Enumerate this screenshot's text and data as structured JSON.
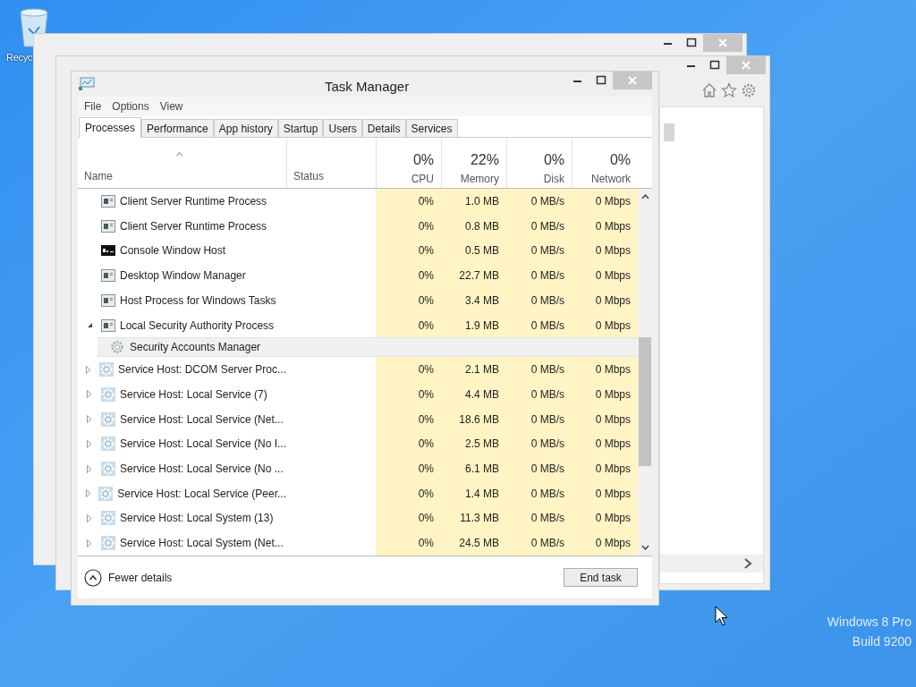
{
  "desktop": {
    "icon_label": "Recyc",
    "watermark": [
      "Windows 8 Pro",
      "Build 9200"
    ]
  },
  "window": {
    "title": "Task Manager"
  },
  "menu": [
    "File",
    "Options",
    "View"
  ],
  "tabs": [
    {
      "label": "Processes",
      "selected": true
    },
    {
      "label": "Performance",
      "selected": false
    },
    {
      "label": "App history",
      "selected": false
    },
    {
      "label": "Startup",
      "selected": false
    },
    {
      "label": "Users",
      "selected": false
    },
    {
      "label": "Details",
      "selected": false
    },
    {
      "label": "Services",
      "selected": false
    }
  ],
  "columns": [
    {
      "label": "Name"
    },
    {
      "label": "Status"
    },
    {
      "label": "CPU",
      "total": "0%"
    },
    {
      "label": "Memory",
      "total": "22%"
    },
    {
      "label": "Disk",
      "total": "0%"
    },
    {
      "label": "Network",
      "total": "0%"
    }
  ],
  "rows": [
    {
      "kind": "app",
      "name": "Client Server Runtime Process",
      "cpu": "0%",
      "memory": "1.0 MB",
      "disk": "0 MB/s",
      "network": "0 Mbps"
    },
    {
      "kind": "app",
      "name": "Client Server Runtime Process",
      "cpu": "0%",
      "memory": "0.8 MB",
      "disk": "0 MB/s",
      "network": "0 Mbps"
    },
    {
      "kind": "console",
      "name": "Console Window Host",
      "cpu": "0%",
      "memory": "0.5 MB",
      "disk": "0 MB/s",
      "network": "0 Mbps"
    },
    {
      "kind": "app",
      "name": "Desktop Window Manager",
      "cpu": "0%",
      "memory": "22.7 MB",
      "disk": "0 MB/s",
      "network": "0 Mbps"
    },
    {
      "kind": "app",
      "name": "Host Process for Windows Tasks",
      "cpu": "0%",
      "memory": "3.4 MB",
      "disk": "0 MB/s",
      "network": "0 Mbps"
    },
    {
      "kind": "app",
      "name": "Local Security Authority Process",
      "expanded": true,
      "cpu": "0%",
      "memory": "1.9 MB",
      "disk": "0 MB/s",
      "network": "0 Mbps"
    },
    {
      "kind": "child",
      "name": "Security Accounts Manager"
    },
    {
      "kind": "service",
      "name": "Service Host: DCOM Server Proc...",
      "expanded": false,
      "cpu": "0%",
      "memory": "2.1 MB",
      "disk": "0 MB/s",
      "network": "0 Mbps"
    },
    {
      "kind": "service",
      "name": "Service Host: Local Service (7)",
      "expanded": false,
      "cpu": "0%",
      "memory": "4.4 MB",
      "disk": "0 MB/s",
      "network": "0 Mbps"
    },
    {
      "kind": "service",
      "name": "Service Host: Local Service (Net...",
      "expanded": false,
      "cpu": "0%",
      "memory": "18.6 MB",
      "disk": "0 MB/s",
      "network": "0 Mbps"
    },
    {
      "kind": "service",
      "name": "Service Host: Local Service (No I...",
      "expanded": false,
      "cpu": "0%",
      "memory": "2.5 MB",
      "disk": "0 MB/s",
      "network": "0 Mbps"
    },
    {
      "kind": "service",
      "name": "Service Host: Local Service (No ...",
      "expanded": false,
      "cpu": "0%",
      "memory": "6.1 MB",
      "disk": "0 MB/s",
      "network": "0 Mbps"
    },
    {
      "kind": "service",
      "name": "Service Host: Local Service (Peer...",
      "expanded": false,
      "cpu": "0%",
      "memory": "1.4 MB",
      "disk": "0 MB/s",
      "network": "0 Mbps"
    },
    {
      "kind": "service",
      "name": "Service Host: Local System (13)",
      "expanded": false,
      "cpu": "0%",
      "memory": "11.3 MB",
      "disk": "0 MB/s",
      "network": "0 Mbps"
    },
    {
      "kind": "service",
      "name": "Service Host: Local System (Net...",
      "expanded": false,
      "cpu": "0%",
      "memory": "24.5 MB",
      "disk": "0 MB/s",
      "network": "0 Mbps"
    }
  ],
  "footer": {
    "details_toggle": "Fewer details",
    "end_task": "End task"
  }
}
